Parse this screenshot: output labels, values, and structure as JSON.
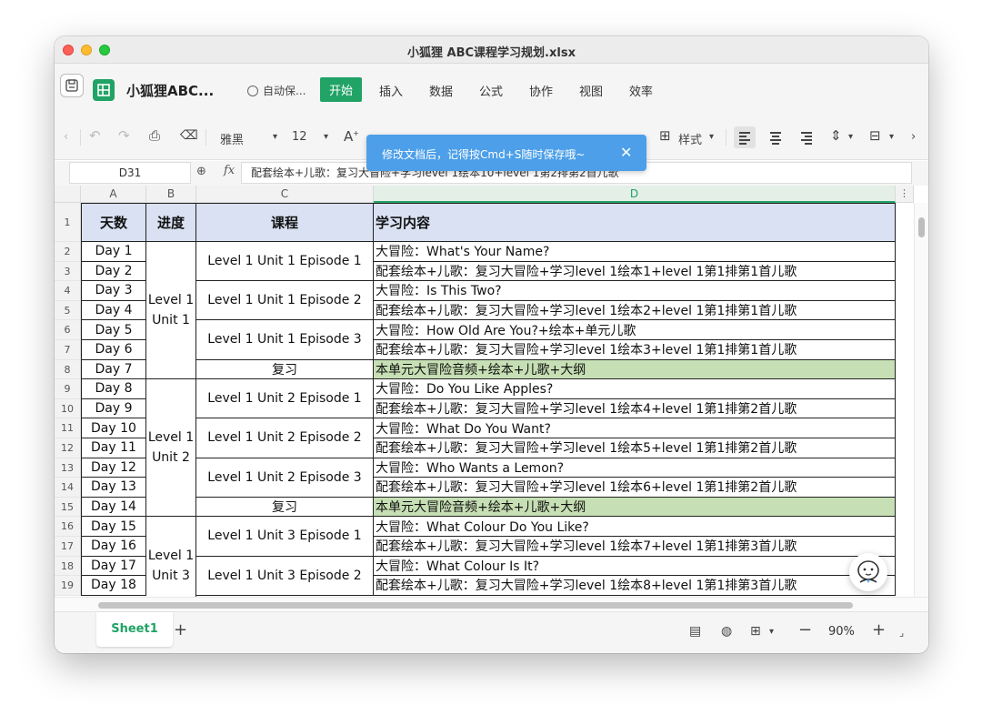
{
  "window": {
    "title": "小狐狸 ABC课程学习规划.xlsx"
  },
  "menubar": {
    "app_name": "小狐狸ABC...",
    "autosave": "自动保...",
    "items": [
      "开始",
      "插入",
      "数据",
      "公式",
      "协作",
      "视图",
      "效率"
    ],
    "active": "开始"
  },
  "toolbar": {
    "font_name": "雅黑",
    "font_size": "12",
    "style_label": "样式"
  },
  "toast": {
    "message": "修改文档后，记得按Cmd+S随时保存哦~"
  },
  "formula_bar": {
    "cell_ref": "D31",
    "formula": "配套绘本+儿歌：复习大冒险+学习level 1绘本10+level 1第2排第2首儿歌"
  },
  "sheet": {
    "columns": [
      "A",
      "B",
      "C",
      "D"
    ],
    "selected_column": "D",
    "headers": {
      "a": "天数",
      "b": "进度",
      "c": "课程",
      "d": "学习内容"
    },
    "rows": [
      {
        "n": "2",
        "day": "Day 1",
        "content": "大冒险：What's Your Name?"
      },
      {
        "n": "3",
        "day": "Day 2",
        "content": "配套绘本+儿歌：复习大冒险+学习level 1绘本1+level 1第1排第1首儿歌"
      },
      {
        "n": "4",
        "day": "Day 3",
        "content": "大冒险：Is This Two?"
      },
      {
        "n": "5",
        "day": "Day 4",
        "content": "配套绘本+儿歌：复习大冒险+学习level 1绘本2+level 1第1排第1首儿歌"
      },
      {
        "n": "6",
        "day": "Day 5",
        "content": "大冒险：How Old Are You?+绘本+单元儿歌"
      },
      {
        "n": "7",
        "day": "Day 6",
        "content": "配套绘本+儿歌：复习大冒险+学习level 1绘本3+level 1第1排第1首儿歌"
      },
      {
        "n": "8",
        "day": "Day 7",
        "content": "本单元大冒险音频+绘本+儿歌+大纲",
        "review": true
      },
      {
        "n": "9",
        "day": "Day 8",
        "content": "大冒险：Do You Like Apples?"
      },
      {
        "n": "10",
        "day": "Day 9",
        "content": "配套绘本+儿歌：复习大冒险+学习level 1绘本4+level 1第1排第2首儿歌"
      },
      {
        "n": "11",
        "day": "Day 10",
        "content": "大冒险：What Do You Want?"
      },
      {
        "n": "12",
        "day": "Day 11",
        "content": "配套绘本+儿歌：复习大冒险+学习level 1绘本5+level 1第1排第2首儿歌"
      },
      {
        "n": "13",
        "day": "Day 12",
        "content": "大冒险：Who Wants a Lemon?"
      },
      {
        "n": "14",
        "day": "Day 13",
        "content": "配套绘本+儿歌：复习大冒险+学习level 1绘本6+level 1第1排第2首儿歌"
      },
      {
        "n": "15",
        "day": "Day 14",
        "content": "本单元大冒险音频+绘本+儿歌+大纲",
        "review": true
      },
      {
        "n": "16",
        "day": "Day 15",
        "content": "大冒险：What Colour Do You Like?"
      },
      {
        "n": "17",
        "day": "Day 16",
        "content": "配套绘本+儿歌：复习大冒险+学习level 1绘本7+level 1第1排第3首儿歌"
      },
      {
        "n": "18",
        "day": "Day 17",
        "content": "大冒险：What Colour Is It?"
      },
      {
        "n": "19",
        "day": "Day 18",
        "content": "配套绘本+儿歌：复习大冒险+学习level 1绘本8+level 1第1排第3首儿歌"
      }
    ],
    "units": [
      {
        "label": "Level 1\nUnit 1",
        "start": 0,
        "span": 7
      },
      {
        "label": "Level 1\nUnit 2",
        "start": 7,
        "span": 7
      },
      {
        "label": "Level 1\nUnit 3",
        "start": 14,
        "span": 5
      }
    ],
    "courses": [
      {
        "label": "Level 1 Unit 1 Episode 1",
        "start": 0,
        "span": 2
      },
      {
        "label": "Level 1 Unit 1 Episode 2",
        "start": 2,
        "span": 2
      },
      {
        "label": "Level 1 Unit 1 Episode 3",
        "start": 4,
        "span": 2
      },
      {
        "label": "复习",
        "start": 6,
        "span": 1
      },
      {
        "label": "Level 1 Unit 2 Episode 1",
        "start": 7,
        "span": 2
      },
      {
        "label": "Level 1 Unit 2 Episode 2",
        "start": 9,
        "span": 2
      },
      {
        "label": "Level 1 Unit 2 Episode 3",
        "start": 11,
        "span": 2
      },
      {
        "label": "复习",
        "start": 13,
        "span": 1
      },
      {
        "label": "Level 1 Unit 3 Episode 1",
        "start": 14,
        "span": 2
      },
      {
        "label": "Level 1 Unit 3 Episode 2",
        "start": 16,
        "span": 2
      }
    ]
  },
  "statusbar": {
    "sheet_tab": "Sheet1",
    "zoom": "90%"
  },
  "colors": {
    "accent": "#21a366",
    "header_fill": "#d9e1f2",
    "review_fill": "#c6dfb4",
    "toast": "#4c9fe8"
  }
}
